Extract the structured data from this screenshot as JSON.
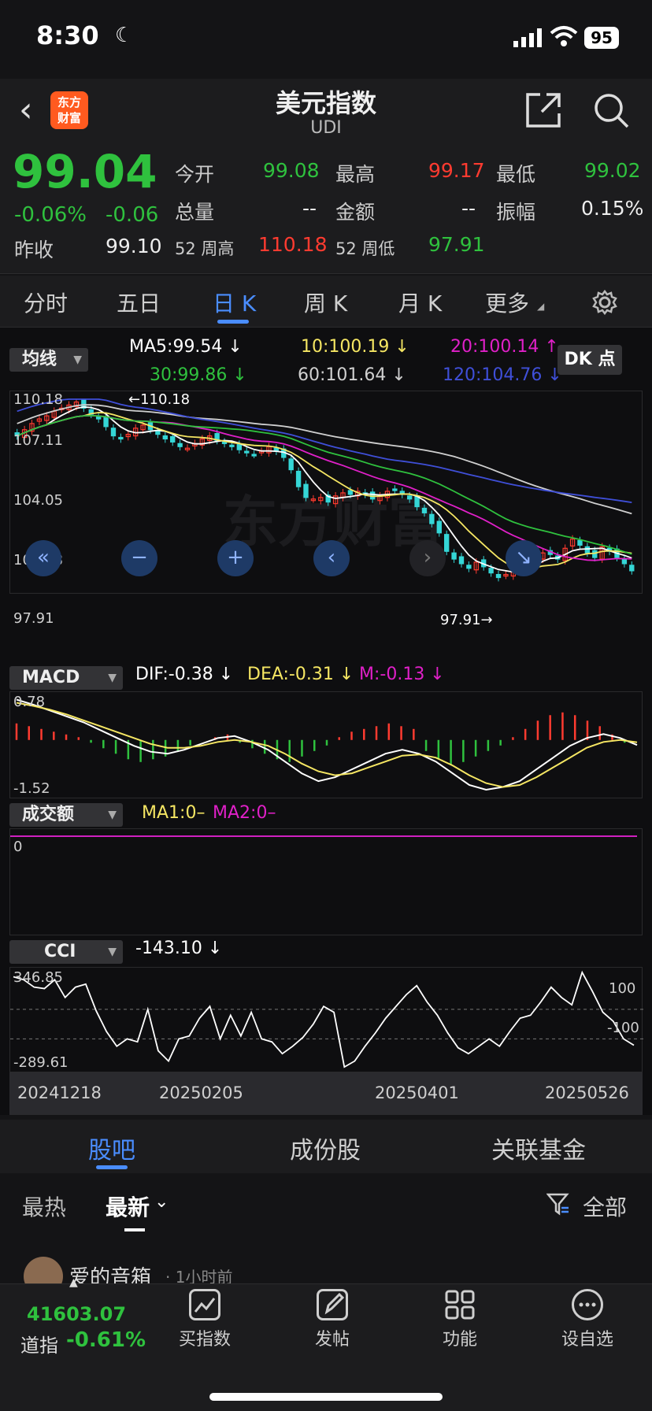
{
  "status_bar": {
    "time": "8:30",
    "battery": "95"
  },
  "header": {
    "title": "美元指数",
    "subtitle": "UDI",
    "logo_line1": "东方",
    "logo_line2": "财富"
  },
  "quote": {
    "price": "99.04",
    "change_pct": "-0.06%",
    "change": "-0.06",
    "prev_close_label": "昨收",
    "prev_close": "99.10",
    "open_label": "今开",
    "open": "99.08",
    "high_label": "最高",
    "high": "99.17",
    "low_label": "最低",
    "low": "99.02",
    "volume_label": "总量",
    "volume": "--",
    "amount_label": "金额",
    "amount": "--",
    "amplitude_label": "振幅",
    "amplitude": "0.15%",
    "w52_high_label": "52 周高",
    "w52_high": "110.18",
    "w52_low_label": "52 周低",
    "w52_low": "97.91",
    "colors": {
      "up": "#ff3b30",
      "down": "#2fc13e"
    }
  },
  "period_tabs": [
    {
      "label": "分时"
    },
    {
      "label": "五日"
    },
    {
      "label": "日 K",
      "active": true
    },
    {
      "label": "周 K"
    },
    {
      "label": "月 K"
    },
    {
      "label": "更多"
    }
  ],
  "ma_panel": {
    "selector": "均线",
    "ma5": "MA5:99.54 ↓",
    "ma10": "10:100.19 ↓",
    "ma20": "20:100.14 ↑",
    "ma30": "30:99.86 ↓",
    "ma60": "60:101.64 ↓",
    "ma120": "120:104.76 ↓",
    "dk_button": "DK 点"
  },
  "chart_data": [
    {
      "type": "candlestick",
      "y_ticks": [
        "110.18",
        "107.11",
        "104.05",
        "100.98",
        "97.91"
      ],
      "ylim": [
        97.91,
        110.18
      ],
      "annotations": [
        "←110.18",
        "97.91→"
      ],
      "x_ticks": [
        "20241218",
        "20250205",
        "20250401",
        "20250526"
      ],
      "closes": [
        107.8,
        108.2,
        108.6,
        108.9,
        109.1,
        109.4,
        109.6,
        109.8,
        110.0,
        109.6,
        109.2,
        108.9,
        108.4,
        107.8,
        107.6,
        107.9,
        108.3,
        108.5,
        108.2,
        107.9,
        107.6,
        107.4,
        107.1,
        107.0,
        107.3,
        107.6,
        107.8,
        107.5,
        107.3,
        107.1,
        106.9,
        106.7,
        106.6,
        106.8,
        107.1,
        106.8,
        106.4,
        105.6,
        104.5,
        103.8,
        103.7,
        103.8,
        103.5,
        103.9,
        104.1,
        104.0,
        104.2,
        104.0,
        103.7,
        103.9,
        104.2,
        104.3,
        104.0,
        103.7,
        103.2,
        102.8,
        102.1,
        101.5,
        100.3,
        99.8,
        99.5,
        99.2,
        99.6,
        99.3,
        98.9,
        98.6,
        98.8,
        99.2,
        99.6,
        99.4,
        99.9,
        100.2,
        100.1,
        99.8,
        100.5,
        101.1,
        100.7,
        100.2,
        99.9,
        100.6,
        100.3,
        99.9,
        99.5,
        99.04
      ],
      "series": [
        {
          "name": "MA5",
          "last": 99.54,
          "color": "#ffffff"
        },
        {
          "name": "MA10",
          "last": 100.19,
          "color": "#f5e663"
        },
        {
          "name": "MA20",
          "last": 100.14,
          "color": "#e020c8"
        },
        {
          "name": "MA30",
          "last": 99.86,
          "color": "#2fc13e"
        },
        {
          "name": "MA60",
          "last": 101.64,
          "color": "#d0d0d0"
        },
        {
          "name": "MA120",
          "last": 104.76,
          "color": "#3f4fd8"
        }
      ]
    },
    {
      "type": "macd",
      "dif": -0.38,
      "dea": -0.31,
      "m": -0.13,
      "y_ticks": [
        "0.78",
        "-1.52"
      ],
      "histogram": [
        0.3,
        0.25,
        0.2,
        0.15,
        0.1,
        0.05,
        -0.05,
        -0.15,
        -0.25,
        -0.35,
        -0.4,
        -0.35,
        -0.3,
        -0.2,
        -0.1,
        0.0,
        0.05,
        0.1,
        -0.05,
        -0.15,
        -0.25,
        -0.35,
        -0.4,
        -0.3,
        -0.2,
        -0.1,
        0.05,
        0.15,
        0.2,
        0.25,
        0.3,
        0.25,
        0.2,
        -0.2,
        -0.35,
        -0.45,
        -0.4,
        -0.3,
        -0.2,
        -0.1,
        0.05,
        0.2,
        0.35,
        0.45,
        0.5,
        0.45,
        0.35,
        0.25,
        0.1,
        -0.05
      ],
      "dif_series": [
        0.78,
        0.65,
        0.5,
        0.35,
        0.2,
        0.0,
        -0.2,
        -0.4,
        -0.55,
        -0.6,
        -0.5,
        -0.35,
        -0.2,
        -0.15,
        -0.3,
        -0.5,
        -0.8,
        -1.1,
        -1.3,
        -1.2,
        -1.0,
        -0.8,
        -0.6,
        -0.5,
        -0.6,
        -0.8,
        -1.1,
        -1.4,
        -1.52,
        -1.45,
        -1.3,
        -1.0,
        -0.7,
        -0.4,
        -0.2,
        -0.1,
        -0.2,
        -0.38
      ],
      "dea_series": [
        0.7,
        0.62,
        0.52,
        0.4,
        0.25,
        0.1,
        -0.05,
        -0.2,
        -0.35,
        -0.45,
        -0.45,
        -0.4,
        -0.3,
        -0.25,
        -0.3,
        -0.4,
        -0.6,
        -0.85,
        -1.05,
        -1.15,
        -1.1,
        -0.95,
        -0.8,
        -0.65,
        -0.62,
        -0.7,
        -0.9,
        -1.15,
        -1.35,
        -1.45,
        -1.4,
        -1.2,
        -0.95,
        -0.7,
        -0.45,
        -0.3,
        -0.25,
        -0.31
      ]
    },
    {
      "type": "volume",
      "selector": "成交额",
      "ma1": "MA1:0–",
      "ma2": "MA2:0–",
      "y_ticks": [
        "0"
      ]
    },
    {
      "type": "cci",
      "selector": "CCI",
      "value": "-143.10 ↓",
      "y_ticks": [
        "346.85",
        "-289.61"
      ],
      "levels": [
        100,
        -100
      ],
      "level_labels": [
        "100",
        "-100"
      ],
      "values": [
        320,
        300,
        250,
        240,
        300,
        180,
        250,
        270,
        90,
        -50,
        -150,
        -100,
        -120,
        100,
        -180,
        -250,
        -100,
        -80,
        40,
        120,
        -100,
        60,
        -80,
        80,
        -100,
        -120,
        -200,
        -150,
        -90,
        0,
        120,
        80,
        -290,
        -250,
        -150,
        -60,
        40,
        120,
        200,
        260,
        150,
        60,
        -60,
        -160,
        -200,
        -150,
        -100,
        -150,
        -50,
        40,
        60,
        150,
        250,
        180,
        130,
        350,
        220,
        80,
        20,
        -100,
        -143
      ]
    }
  ],
  "macd_panel": {
    "selector": "MACD",
    "dif": "DIF:-0.38 ↓",
    "dea": "DEA:-0.31 ↓",
    "m": "M:-0.13 ↓"
  },
  "watermark": "东方财富",
  "content_tabs": [
    {
      "label": "股吧",
      "active": true
    },
    {
      "label": "成份股"
    },
    {
      "label": "关联基金"
    }
  ],
  "feed": {
    "sort_hot": "最热",
    "sort_new": "最新",
    "filter": "全部",
    "post_user": "爱的音箱",
    "post_time": "· 1小时前"
  },
  "bottom_bar": {
    "index_value": "41603.07",
    "index_name": "道指",
    "index_change": "-0.61%",
    "buttons": [
      {
        "label": "买指数"
      },
      {
        "label": "发帖"
      },
      {
        "label": "功能"
      },
      {
        "label": "设自选"
      }
    ]
  }
}
